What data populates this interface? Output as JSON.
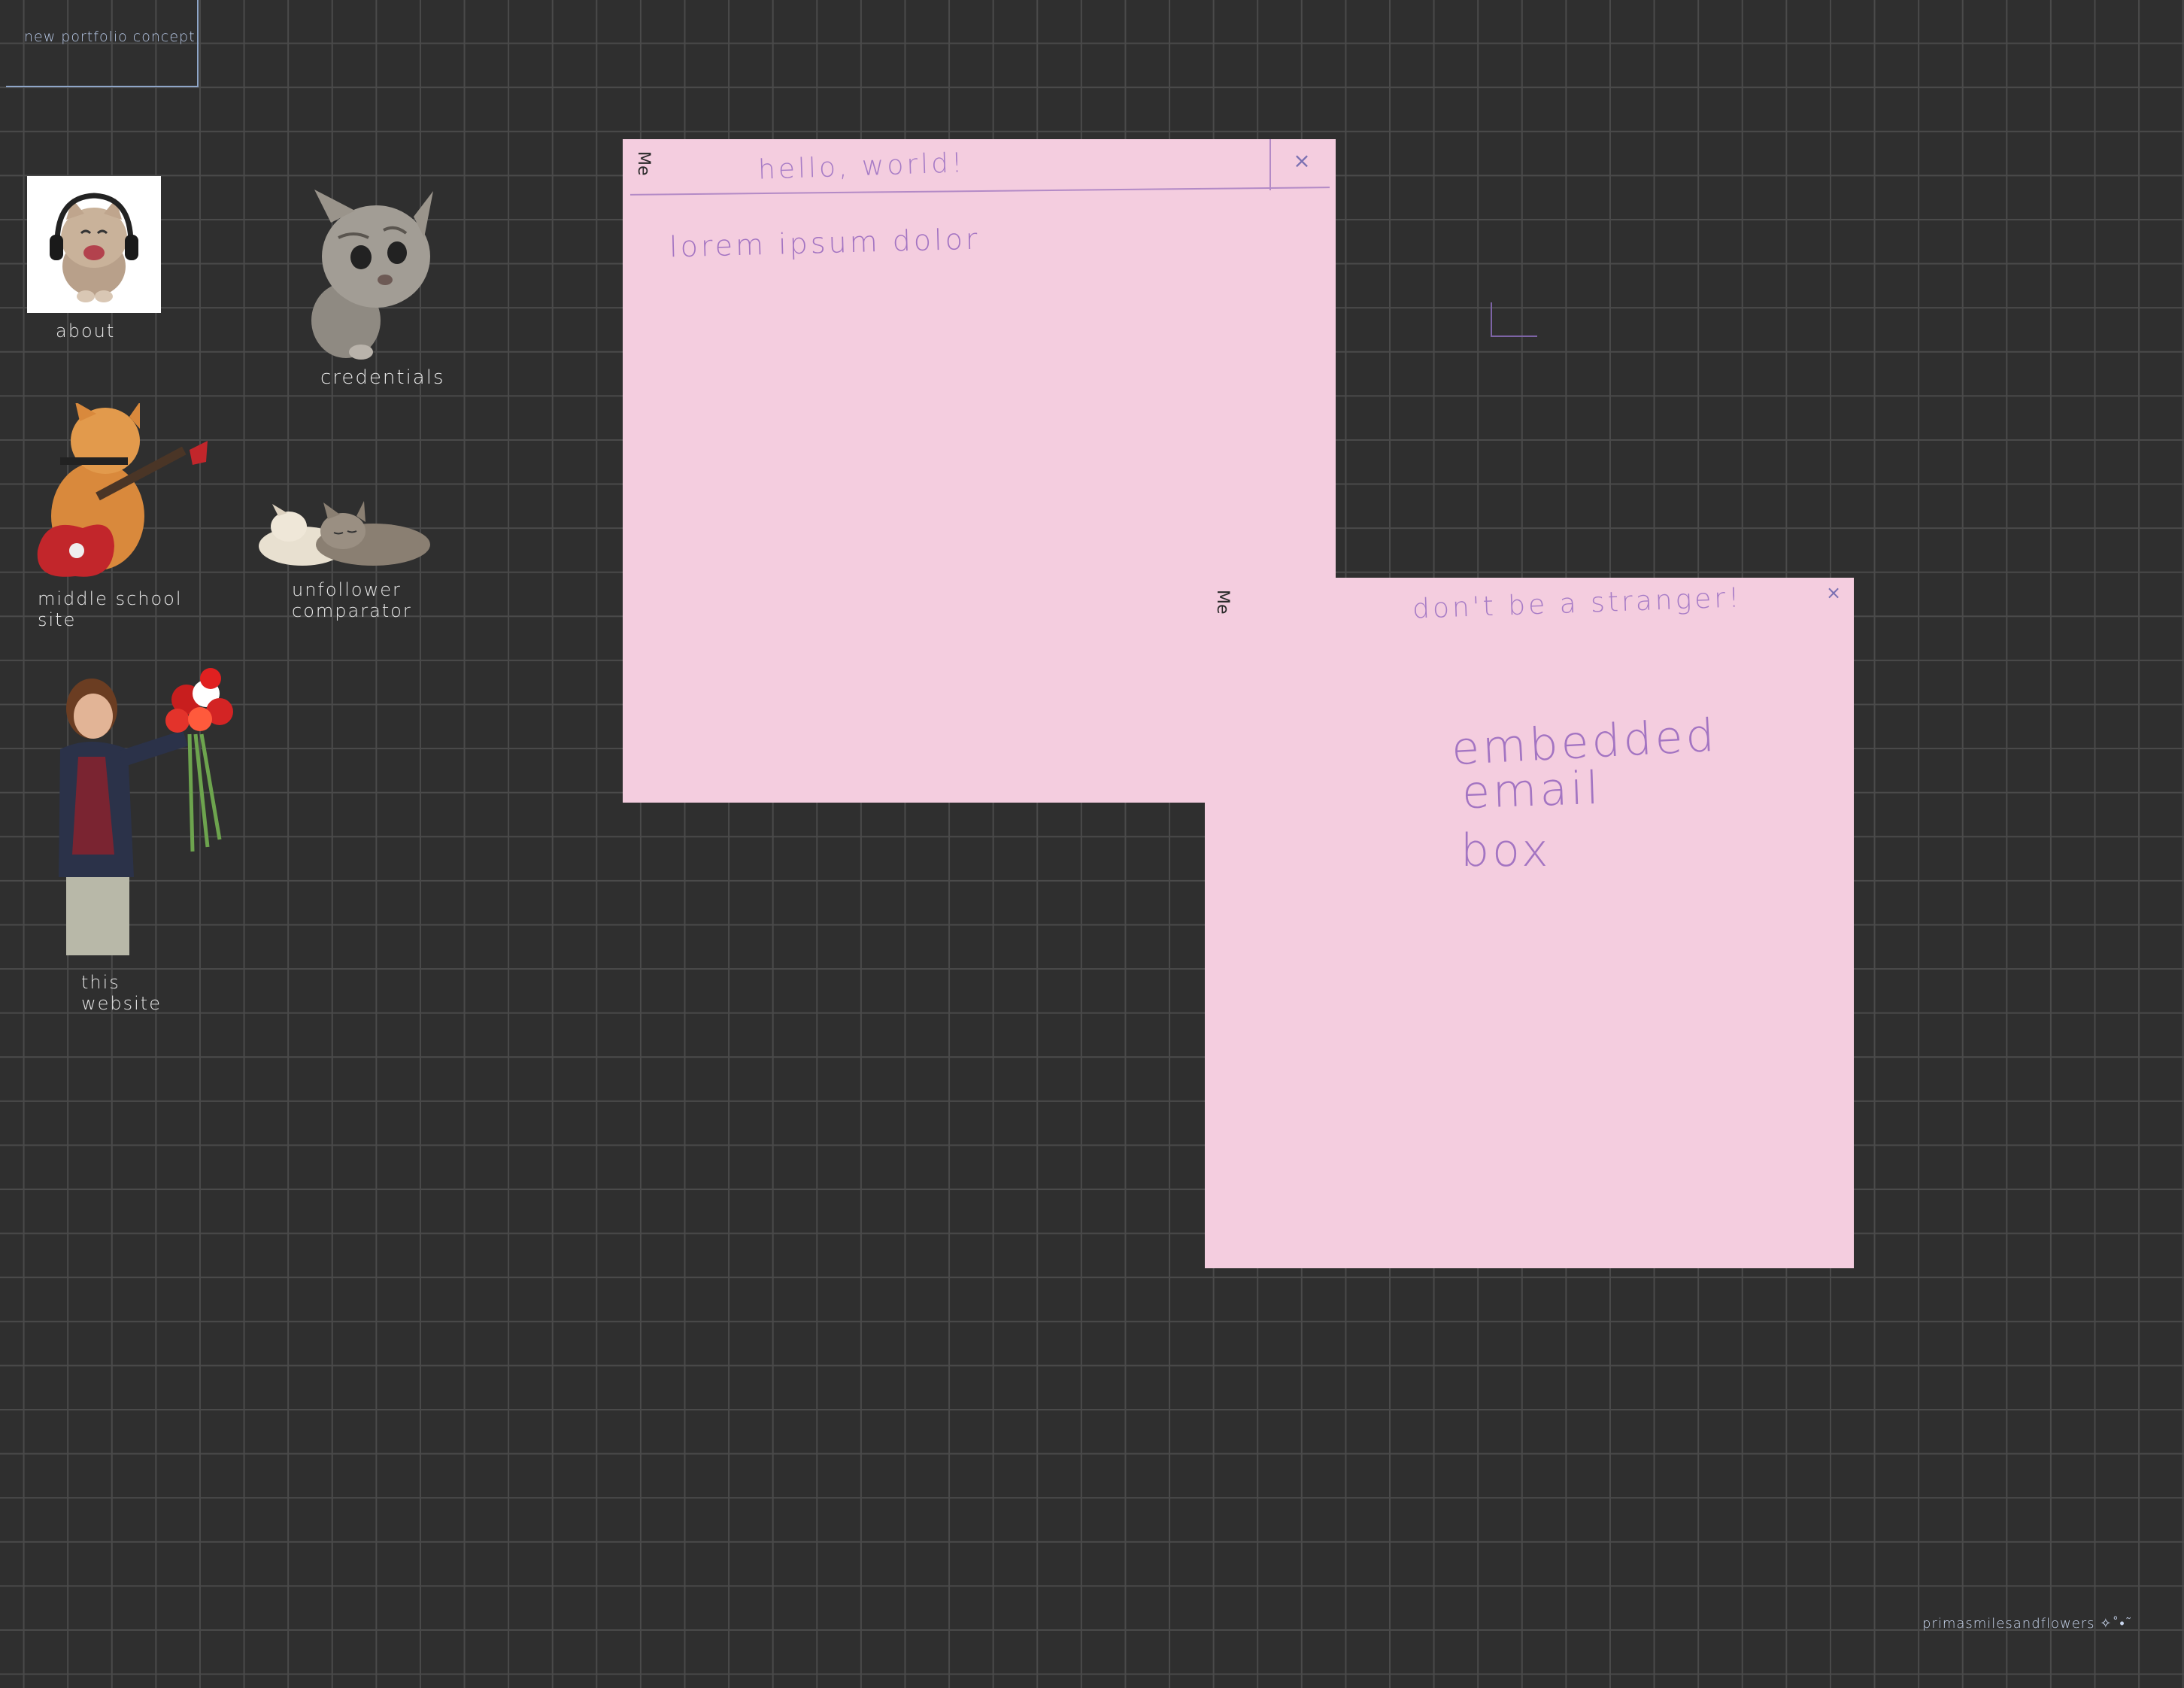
{
  "desktop": {
    "title": "new portfolio concept",
    "signature": "primasmilesandflowers ✧˚•˜",
    "icons": [
      {
        "label": "about",
        "icon": "headphone-cat-icon"
      },
      {
        "label": "credentials",
        "icon": "kitten-icon"
      },
      {
        "label": "middle school site",
        "icon": "guitar-cat-icon"
      },
      {
        "label": "unfollower comparator",
        "icon": "sleeping-kittens-icon"
      },
      {
        "label": "this website",
        "icon": "boy-with-flowers-icon"
      }
    ]
  },
  "windows": [
    {
      "side_label": "Me",
      "title": "hello, world!",
      "close": "×",
      "body": "lorem ipsum dolor"
    },
    {
      "side_label": "Me",
      "title": "don't be a stranger!",
      "close": "×",
      "body_lines": [
        "embedded",
        "email",
        "box"
      ]
    }
  ],
  "colors": {
    "background": "#2f2f2f",
    "grid": "#4a4a4a",
    "window": "#f4cddf",
    "accent_text": "#a77cc6"
  }
}
